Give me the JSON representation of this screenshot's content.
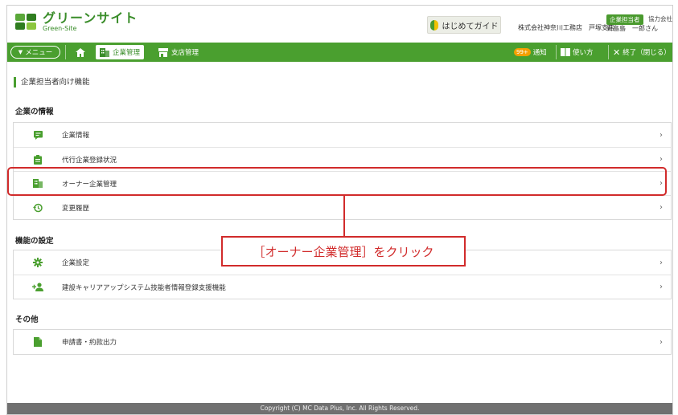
{
  "header": {
    "logo_ja": "グリーンサイト",
    "logo_en": "Green-Site",
    "guide_label": "はじめてガイド",
    "role_badge": "企業担当者",
    "partner_label": "協力会社",
    "company_name": "株式会社神奈川工務店　戸塚支店",
    "user_name": "新島島　一郎さん"
  },
  "nav": {
    "menu_label": "メニュー",
    "tabs": [
      {
        "label": "企業管理",
        "active": true
      },
      {
        "label": "支店管理",
        "active": false
      }
    ],
    "notify_badge": "99+",
    "notify_label": "通知",
    "help_label": "使い方",
    "exit_label": "終了（閉じる）"
  },
  "page": {
    "title": "企業担当者向け機能"
  },
  "sections": [
    {
      "heading": "企業の情報",
      "items": [
        {
          "label": "企業情報",
          "icon": "message-icon"
        },
        {
          "label": "代行企業登録状況",
          "icon": "clipboard-icon"
        },
        {
          "label": "オーナー企業管理",
          "icon": "building-icon"
        },
        {
          "label": "変更履歴",
          "icon": "history-icon"
        }
      ]
    },
    {
      "heading": "機能の設定",
      "items": [
        {
          "label": "企業設定",
          "icon": "gear-icon"
        },
        {
          "label": "建設キャリアアップシステム技能者情報登録支援機能",
          "icon": "add-person-icon"
        }
      ]
    },
    {
      "heading": "その他",
      "items": [
        {
          "label": "申請書・約款出力",
          "icon": "document-icon"
        }
      ]
    }
  ],
  "annotation": {
    "callout": "［オーナー企業管理］をクリック"
  },
  "footer": {
    "copyright": "Copyright (C) MC Data Plus, Inc. All Rights Reserved."
  },
  "colors": {
    "brand_green": "#4a9f2f",
    "highlight_red": "#d12b2b"
  }
}
